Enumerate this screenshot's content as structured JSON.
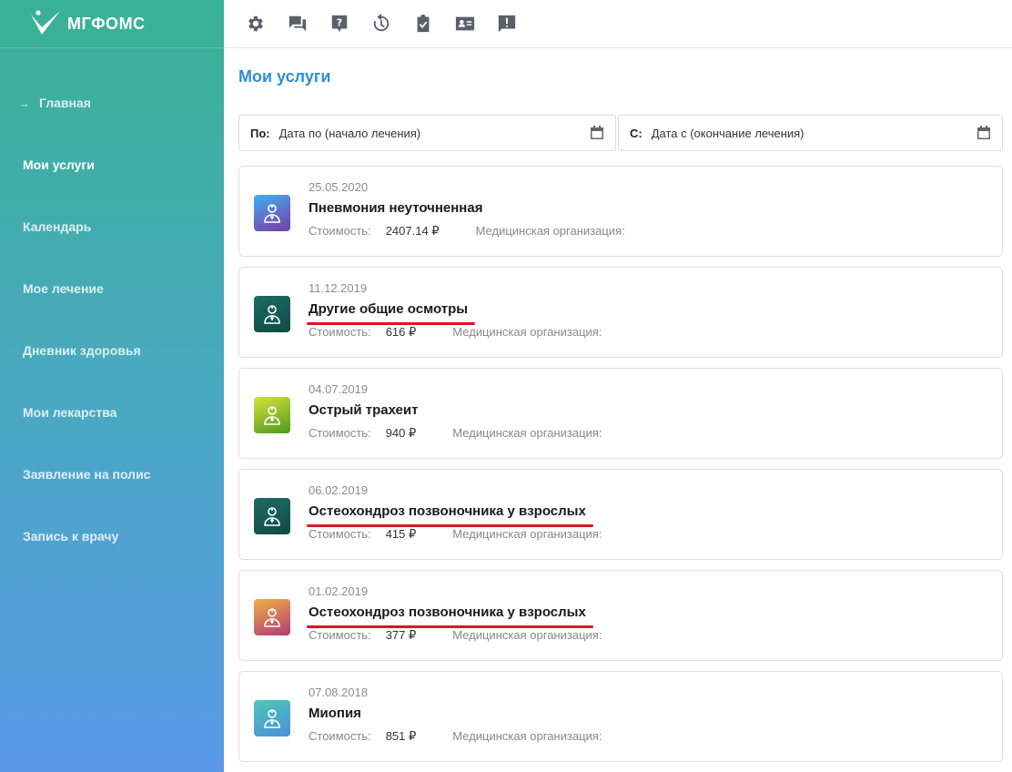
{
  "app": {
    "logo_text": "МГФОМС"
  },
  "sidebar": {
    "items": [
      {
        "label": "Главная",
        "arrow": "→"
      },
      {
        "label": "Мои услуги"
      },
      {
        "label": "Календарь"
      },
      {
        "label": "Мое лечение"
      },
      {
        "label": "Дневник здоровья"
      },
      {
        "label": "Мои лекарства"
      },
      {
        "label": "Заявление на полис"
      },
      {
        "label": "Запись к врачу"
      }
    ]
  },
  "topbar": {
    "icons": [
      "gear-icon",
      "chat-icon",
      "help-icon",
      "history-icon",
      "clipboard-check-icon",
      "contact-card-icon",
      "feedback-icon"
    ]
  },
  "main": {
    "title": "Мои услуги",
    "filters": {
      "to": {
        "label": "По:",
        "placeholder": "Дата по (начало лечения)"
      },
      "from": {
        "label": "С:",
        "placeholder": "Дата с (окончание лечения)"
      }
    },
    "cost_label": "Стоимость:",
    "org_label": "Медицинская организация:",
    "services": [
      {
        "date": "25.05.2020",
        "title": "Пневмония неуточненная",
        "cost": "2407.14 ₽",
        "underlined": false,
        "icon_gradient": [
          "#3fb0f0",
          "#7a3ba8"
        ]
      },
      {
        "date": "11.12.2019",
        "title": "Другие общие осмотры",
        "cost": "616 ₽",
        "underlined": true,
        "icon_gradient": [
          "#1e6b62",
          "#0f4a47"
        ]
      },
      {
        "date": "04.07.2019",
        "title": "Острый трахеит",
        "cost": "940 ₽",
        "underlined": false,
        "icon_gradient": [
          "#d8e03a",
          "#4d9a1e"
        ]
      },
      {
        "date": "06.02.2019",
        "title": "Остеохондроз позвоночника у взрослых",
        "cost": "415 ₽",
        "underlined": true,
        "icon_gradient": [
          "#1e6b62",
          "#0f4a47"
        ]
      },
      {
        "date": "01.02.2019",
        "title": "Остеохондроз позвоночника у взрослых",
        "cost": "377 ₽",
        "underlined": true,
        "icon_gradient": [
          "#f0b040",
          "#b03a7a"
        ]
      },
      {
        "date": "07.08.2018",
        "title": "Миопия",
        "cost": "851 ₽",
        "underlined": false,
        "icon_gradient": [
          "#4fc6b8",
          "#4a90d8"
        ]
      }
    ]
  }
}
